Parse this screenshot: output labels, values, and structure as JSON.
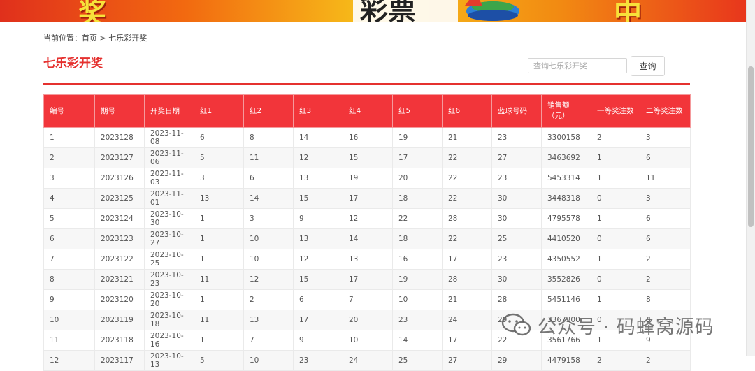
{
  "banner": {
    "left_glyph": "奖",
    "right_glyph": "中",
    "logo_text": "彩票"
  },
  "breadcrumb": {
    "prefix": "当前位置：",
    "home": "首页",
    "separator": " > ",
    "current": "七乐彩开奖"
  },
  "page_title": "七乐彩开奖",
  "search": {
    "placeholder": "查询七乐彩开奖",
    "value": "",
    "button_label": "查询"
  },
  "table": {
    "headers": [
      "编号",
      "期号",
      "开奖日期",
      "红1",
      "红2",
      "红3",
      "红4",
      "红5",
      "红6",
      "蓝球号码",
      "销售额\n（元）",
      "一等奖注数",
      "二等奖注数"
    ],
    "rows": [
      [
        "1",
        "2023128",
        "2023-11-08",
        "6",
        "8",
        "14",
        "16",
        "19",
        "21",
        "23",
        "3300158",
        "2",
        "3"
      ],
      [
        "2",
        "2023127",
        "2023-11-06",
        "5",
        "11",
        "12",
        "15",
        "17",
        "22",
        "27",
        "3463692",
        "1",
        "6"
      ],
      [
        "3",
        "2023126",
        "2023-11-03",
        "3",
        "6",
        "13",
        "19",
        "20",
        "22",
        "23",
        "5453314",
        "1",
        "11"
      ],
      [
        "4",
        "2023125",
        "2023-11-01",
        "13",
        "14",
        "15",
        "17",
        "18",
        "22",
        "30",
        "3448318",
        "0",
        "3"
      ],
      [
        "5",
        "2023124",
        "2023-10-30",
        "1",
        "3",
        "9",
        "12",
        "22",
        "28",
        "30",
        "4795578",
        "1",
        "6"
      ],
      [
        "6",
        "2023123",
        "2023-10-27",
        "1",
        "10",
        "13",
        "14",
        "18",
        "22",
        "25",
        "4410520",
        "0",
        "6"
      ],
      [
        "7",
        "2023122",
        "2023-10-25",
        "1",
        "10",
        "12",
        "13",
        "16",
        "17",
        "23",
        "4350552",
        "1",
        "2"
      ],
      [
        "8",
        "2023121",
        "2023-10-23",
        "11",
        "12",
        "15",
        "17",
        "19",
        "28",
        "30",
        "3552826",
        "0",
        "2"
      ],
      [
        "9",
        "2023120",
        "2023-10-20",
        "1",
        "2",
        "6",
        "7",
        "10",
        "21",
        "28",
        "5451146",
        "1",
        "8"
      ],
      [
        "10",
        "2023119",
        "2023-10-18",
        "11",
        "13",
        "17",
        "20",
        "23",
        "24",
        "29",
        "3367300",
        "0",
        "3"
      ],
      [
        "11",
        "2023118",
        "2023-10-16",
        "1",
        "7",
        "9",
        "10",
        "14",
        "17",
        "22",
        "3561766",
        "1",
        "9"
      ],
      [
        "12",
        "2023117",
        "2023-10-13",
        "5",
        "10",
        "23",
        "24",
        "25",
        "27",
        "29",
        "4479158",
        "2",
        "2"
      ]
    ]
  },
  "watermark": {
    "text": "公众号 · 码蜂窝源码",
    "icon": "wechat-icon"
  },
  "colors": {
    "accent": "#e5312f",
    "header_bg": "#f2353a"
  }
}
